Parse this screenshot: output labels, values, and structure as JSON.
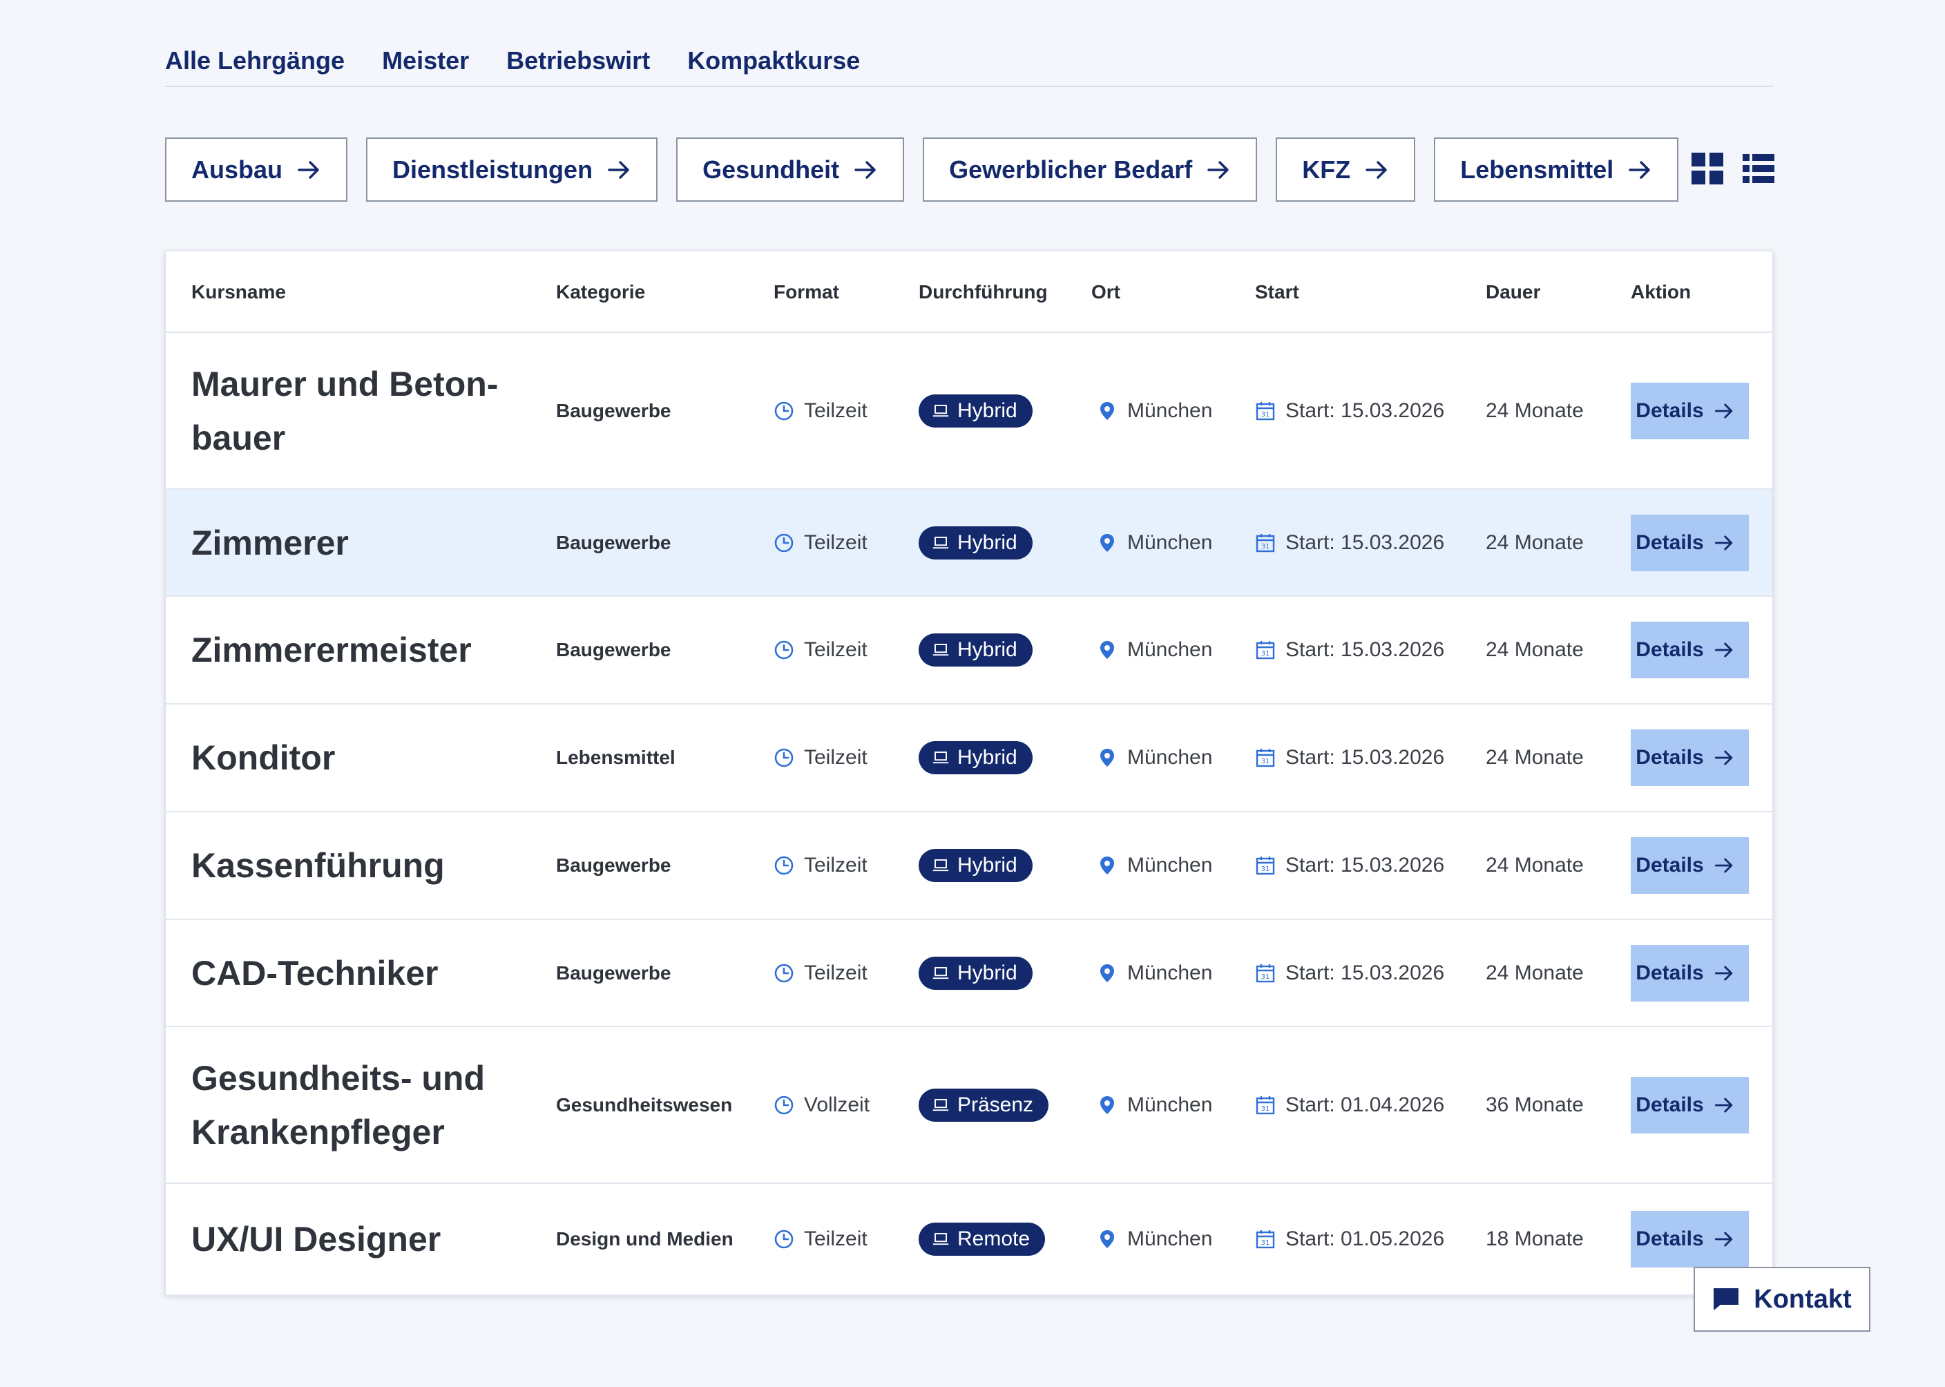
{
  "tabs": [
    "Alle Lehrgänge",
    "Meister",
    "Betriebswirt",
    "Kompaktkurse"
  ],
  "chips": [
    "Ausbau",
    "Dienstleistungen",
    "Gesundheit",
    "Gewerblicher Bedarf",
    "KFZ",
    "Lebensmittel"
  ],
  "view_icons": [
    "grid-view-icon",
    "list-view-icon"
  ],
  "table": {
    "headers": [
      "Kursname",
      "Kategorie",
      "Format",
      "Durchführung",
      "Ort",
      "Start",
      "Dauer",
      "Aktion"
    ],
    "rows": [
      {
        "name": "Maurer und Beton-bauer",
        "category": "Baugewerbe",
        "format": "Teilzeit",
        "mode": "Hybrid",
        "location": "München",
        "start": "Start: 15.03.2026",
        "duration": "24 Monate",
        "action": "Details"
      },
      {
        "name": "Zimmerer",
        "category": "Baugewerbe",
        "format": "Teilzeit",
        "mode": "Hybrid",
        "location": "München",
        "start": "Start: 15.03.2026",
        "duration": "24 Monate",
        "action": "Details"
      },
      {
        "name": "Zimmerermeister",
        "category": "Baugewerbe",
        "format": "Teilzeit",
        "mode": "Hybrid",
        "location": "München",
        "start": "Start: 15.03.2026",
        "duration": "24 Monate",
        "action": "Details"
      },
      {
        "name": "Konditor",
        "category": "Lebensmittel",
        "format": "Teilzeit",
        "mode": "Hybrid",
        "location": "München",
        "start": "Start: 15.03.2026",
        "duration": "24 Monate",
        "action": "Details"
      },
      {
        "name": "Kassenführung",
        "category": "Baugewerbe",
        "format": "Teilzeit",
        "mode": "Hybrid",
        "location": "München",
        "start": "Start: 15.03.2026",
        "duration": "24 Monate",
        "action": "Details"
      },
      {
        "name": "CAD-Techniker",
        "category": "Baugewerbe",
        "format": "Teilzeit",
        "mode": "Hybrid",
        "location": "München",
        "start": "Start: 15.03.2026",
        "duration": "24 Monate",
        "action": "Details"
      },
      {
        "name": "Gesundheits- und Krankenpfleger",
        "category": "Gesundheitswesen",
        "format": "Vollzeit",
        "mode": "Präsenz",
        "location": "München",
        "start": "Start: 01.04.2026",
        "duration": "36 Monate",
        "action": "Details"
      },
      {
        "name": "UX/UI Designer",
        "category": "Design und Medien",
        "format": "Teilzeit",
        "mode": "Remote",
        "location": "München",
        "start": "Start: 01.05.2026",
        "duration": "18 Monate",
        "action": "Details"
      }
    ]
  },
  "kontakt": {
    "label": "Kontakt"
  },
  "colors": {
    "primary": "#13296b",
    "details_bg": "#a9c9f4",
    "highlight_row": "#e7f0fd",
    "icon_blue": "#2f6fd6",
    "page_bg": "#f4f6fb"
  }
}
